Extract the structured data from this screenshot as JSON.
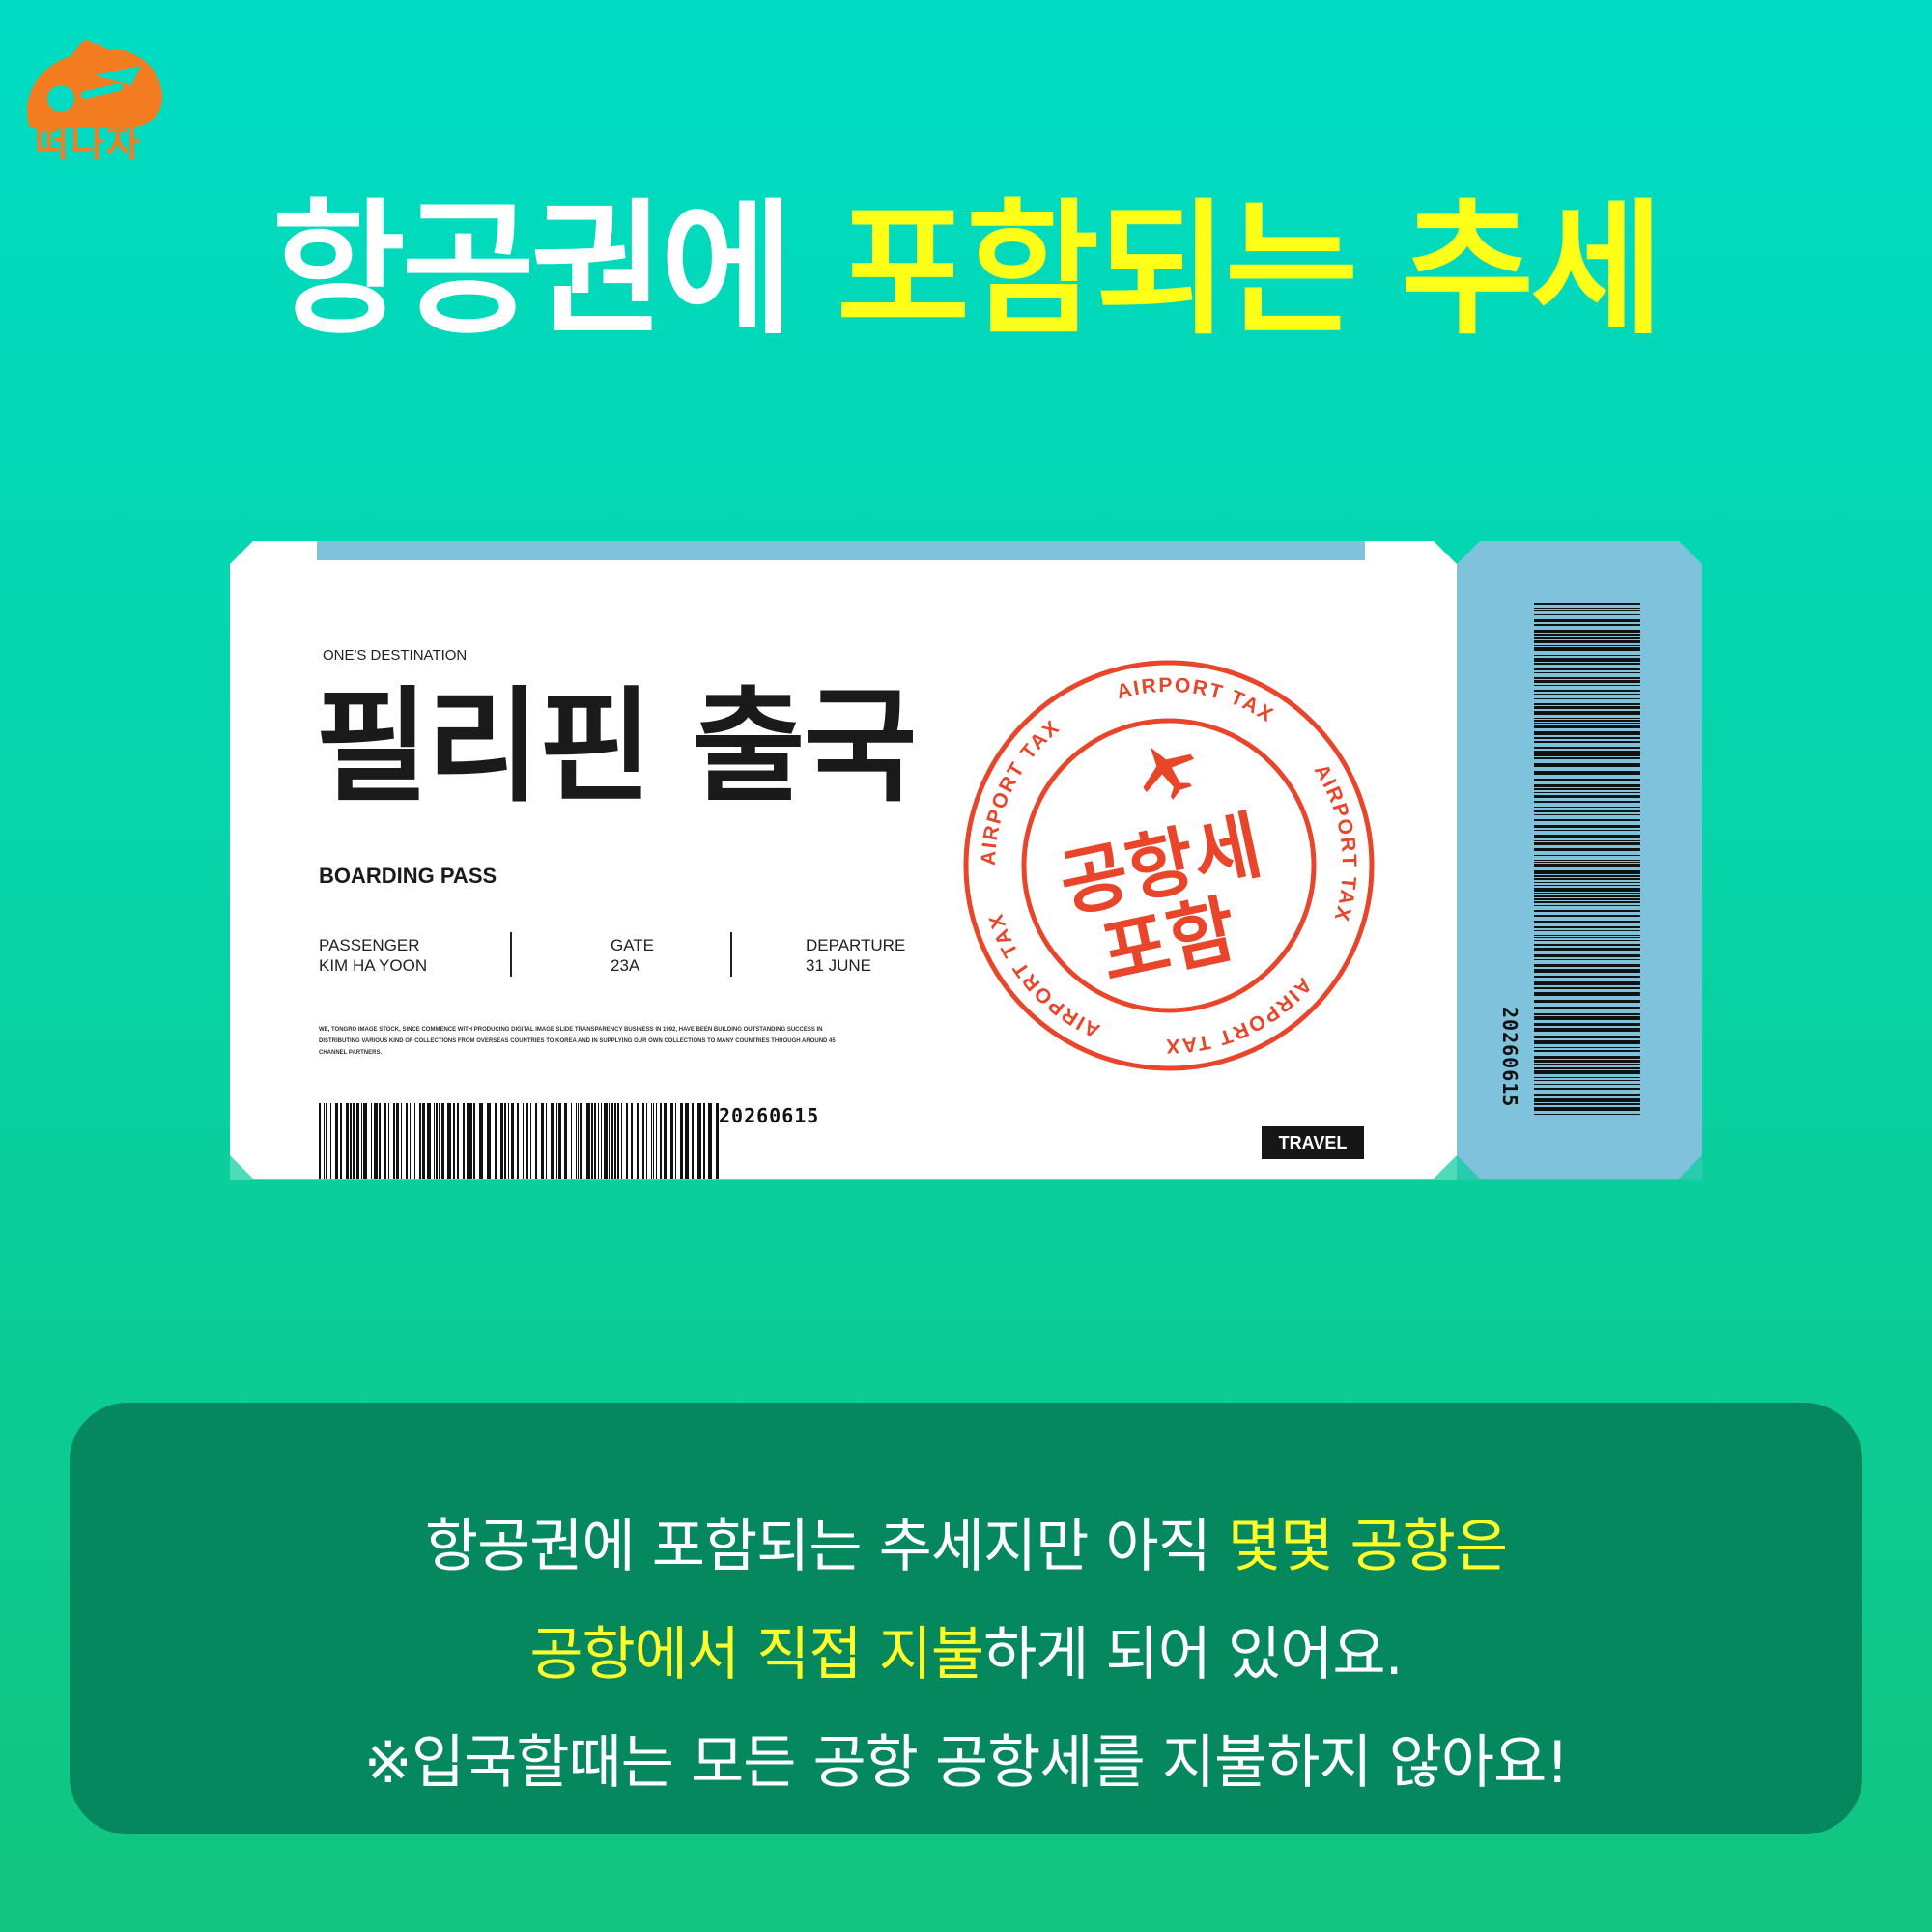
{
  "brand": {
    "name": "떠나자",
    "color": "#f47c20"
  },
  "headline": {
    "part1": "항공권에",
    "part2": "포함되는 추세"
  },
  "ticket": {
    "dest_label": "ONE'S DESTINATION",
    "dest_title": "필리핀 출국",
    "boarding_pass": "BOARDING PASS",
    "passenger_label": "PASSENGER",
    "passenger_value": "KIM HA YOON",
    "gate_label": "GATE",
    "gate_value": "23A",
    "departure_label": "DEPARTURE",
    "departure_value": "31 JUNE",
    "fine_print": "WE, TONGRO IMAGE STOCK, SINCE COMMENCE WITH PRODUCING DIGITAL IMAGE SLIDE TRANSPARENCY BUSINESS IN 1992, HAVE BEEN BUILDING OUTSTANDING SUCCESS IN DISTRIBUTING VARIOUS KIND OF COLLECTIONS FROM OVERSEAS COUNTRIES TO KOREA AND IN SUPPLYING OUR OWN COLLECTIONS TO MANY COUNTRIES THROUGH AROUND 45 CHANNEL PARTNERS.",
    "code": "20260615",
    "tag": "TRAVEL",
    "stub_code": "20260615"
  },
  "stamp": {
    "ring_text": "AIRPORT TAX",
    "center_line1": "공항세",
    "center_line2": "포함",
    "color": "#e8452a",
    "icon": "airplane-icon"
  },
  "caption": {
    "line1_a": "항공권에 포함되는 추세지만 아직 ",
    "line1_b": "몇몇 공항은",
    "line2_a": "공항에서 직접 지불",
    "line2_b": "하게 되어 있어요.",
    "line3": "※입국할때는 모든 공항 공항세를 지불하지 않아요!"
  },
  "colors": {
    "background": "#00dcc4",
    "highlight": "#ffff17",
    "stub": "#7ec2dc",
    "panel": "#06815a"
  }
}
